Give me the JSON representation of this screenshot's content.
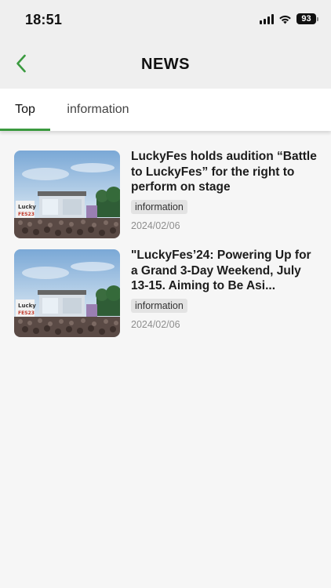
{
  "status_bar": {
    "time": "18:51",
    "battery_level": "93",
    "icons": [
      "signal-icon",
      "wifi-icon",
      "battery-icon"
    ]
  },
  "nav": {
    "title": "NEWS",
    "back_icon": "chevron-left-icon",
    "accent_color": "#3a9a3f"
  },
  "tabs": [
    {
      "label": "Top",
      "selected": true
    },
    {
      "label": "information",
      "selected": false
    }
  ],
  "news": [
    {
      "title": "LuckyFes holds audition “Battle to LuckyFes” for the right to perform on stage",
      "tag": "information",
      "date": "2024/02/06",
      "thumbnail_logo": "Lucky FES'23"
    },
    {
      "title": "\"LuckyFes’24: Powering Up for a Grand 3-Day Weekend, July 13-15. Aiming to Be Asi...",
      "tag": "information",
      "date": "2024/02/06",
      "thumbnail_logo": "Lucky FES'23"
    }
  ]
}
